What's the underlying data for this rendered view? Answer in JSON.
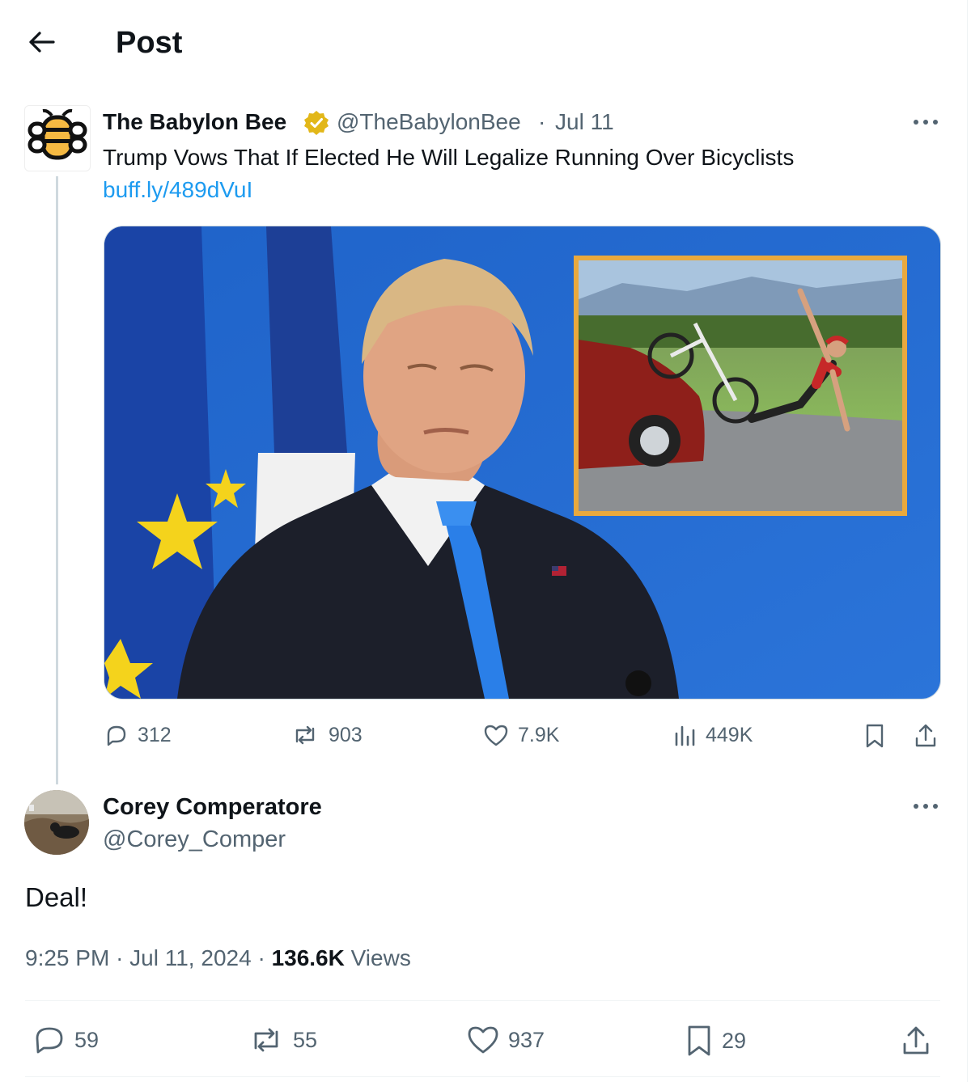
{
  "header": {
    "title": "Post"
  },
  "quoted_tweet": {
    "author_name": "The Babylon Bee",
    "handle": "@TheBabylonBee",
    "separator": "·",
    "date": "Jul 11",
    "text": "Trump Vows That If Elected He Will Legalize Running Over Bicyclists",
    "link": "buff.ly/489dVuI",
    "stats": {
      "replies": "312",
      "reposts": "903",
      "likes": "7.9K",
      "views": "449K"
    }
  },
  "reply_tweet": {
    "author_name": "Corey Comperatore",
    "handle": "@Corey_Comper",
    "text": "Deal!",
    "time": "9:25 PM",
    "date": "Jul 11, 2024",
    "separator": "·",
    "views_count": "136.6K",
    "views_label": "Views",
    "stats": {
      "replies": "59",
      "reposts": "55",
      "likes": "937",
      "bookmarks": "29"
    }
  },
  "colors": {
    "accent": "#1d9bf0",
    "muted": "#536471",
    "text": "#0f1419",
    "verified_gold": "#e2b719"
  }
}
